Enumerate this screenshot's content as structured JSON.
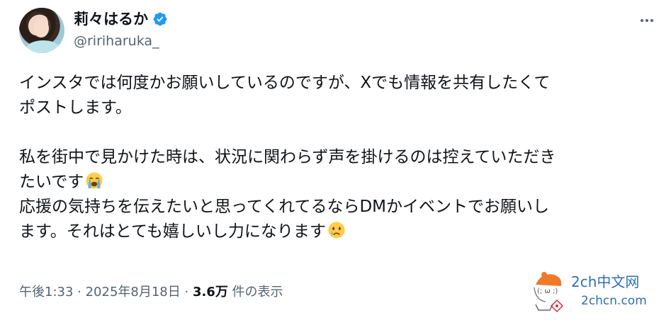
{
  "author": {
    "display_name": "莉々はるか",
    "handle": "@ririharuka_",
    "verified": true
  },
  "post": {
    "lines": [
      "インスタでは何度かお願いしているのですが、Xでも情報を共有したくて",
      "ポストします。",
      "",
      "私を街中で見かけた時は、状況に関わらず声を掛けるのは控えていただき",
      "たいです",
      "応援の気持ちを伝えたいと思ってくれてるならDMかイベントでお願いし",
      "ます。それはとても嬉しいし力になります"
    ]
  },
  "meta": {
    "time": "午後1:33",
    "separator1": " · ",
    "date": "2025年8月18日",
    "separator2": " · ",
    "views_count": "3.6万",
    "views_label": " 件の表示"
  },
  "watermark": {
    "line1": "2ch中文网",
    "line2": "2chcn.com"
  },
  "colors": {
    "text": "#0f1419",
    "secondary": "#536471",
    "verified": "#1d9bf0",
    "watermark": "#2f6fb5"
  },
  "icons": {
    "verified": "verified-badge-icon",
    "more": "more-horizontal-icon",
    "emoji1": "loudly-crying-face-emoji",
    "emoji2": "crying-face-emoji"
  }
}
